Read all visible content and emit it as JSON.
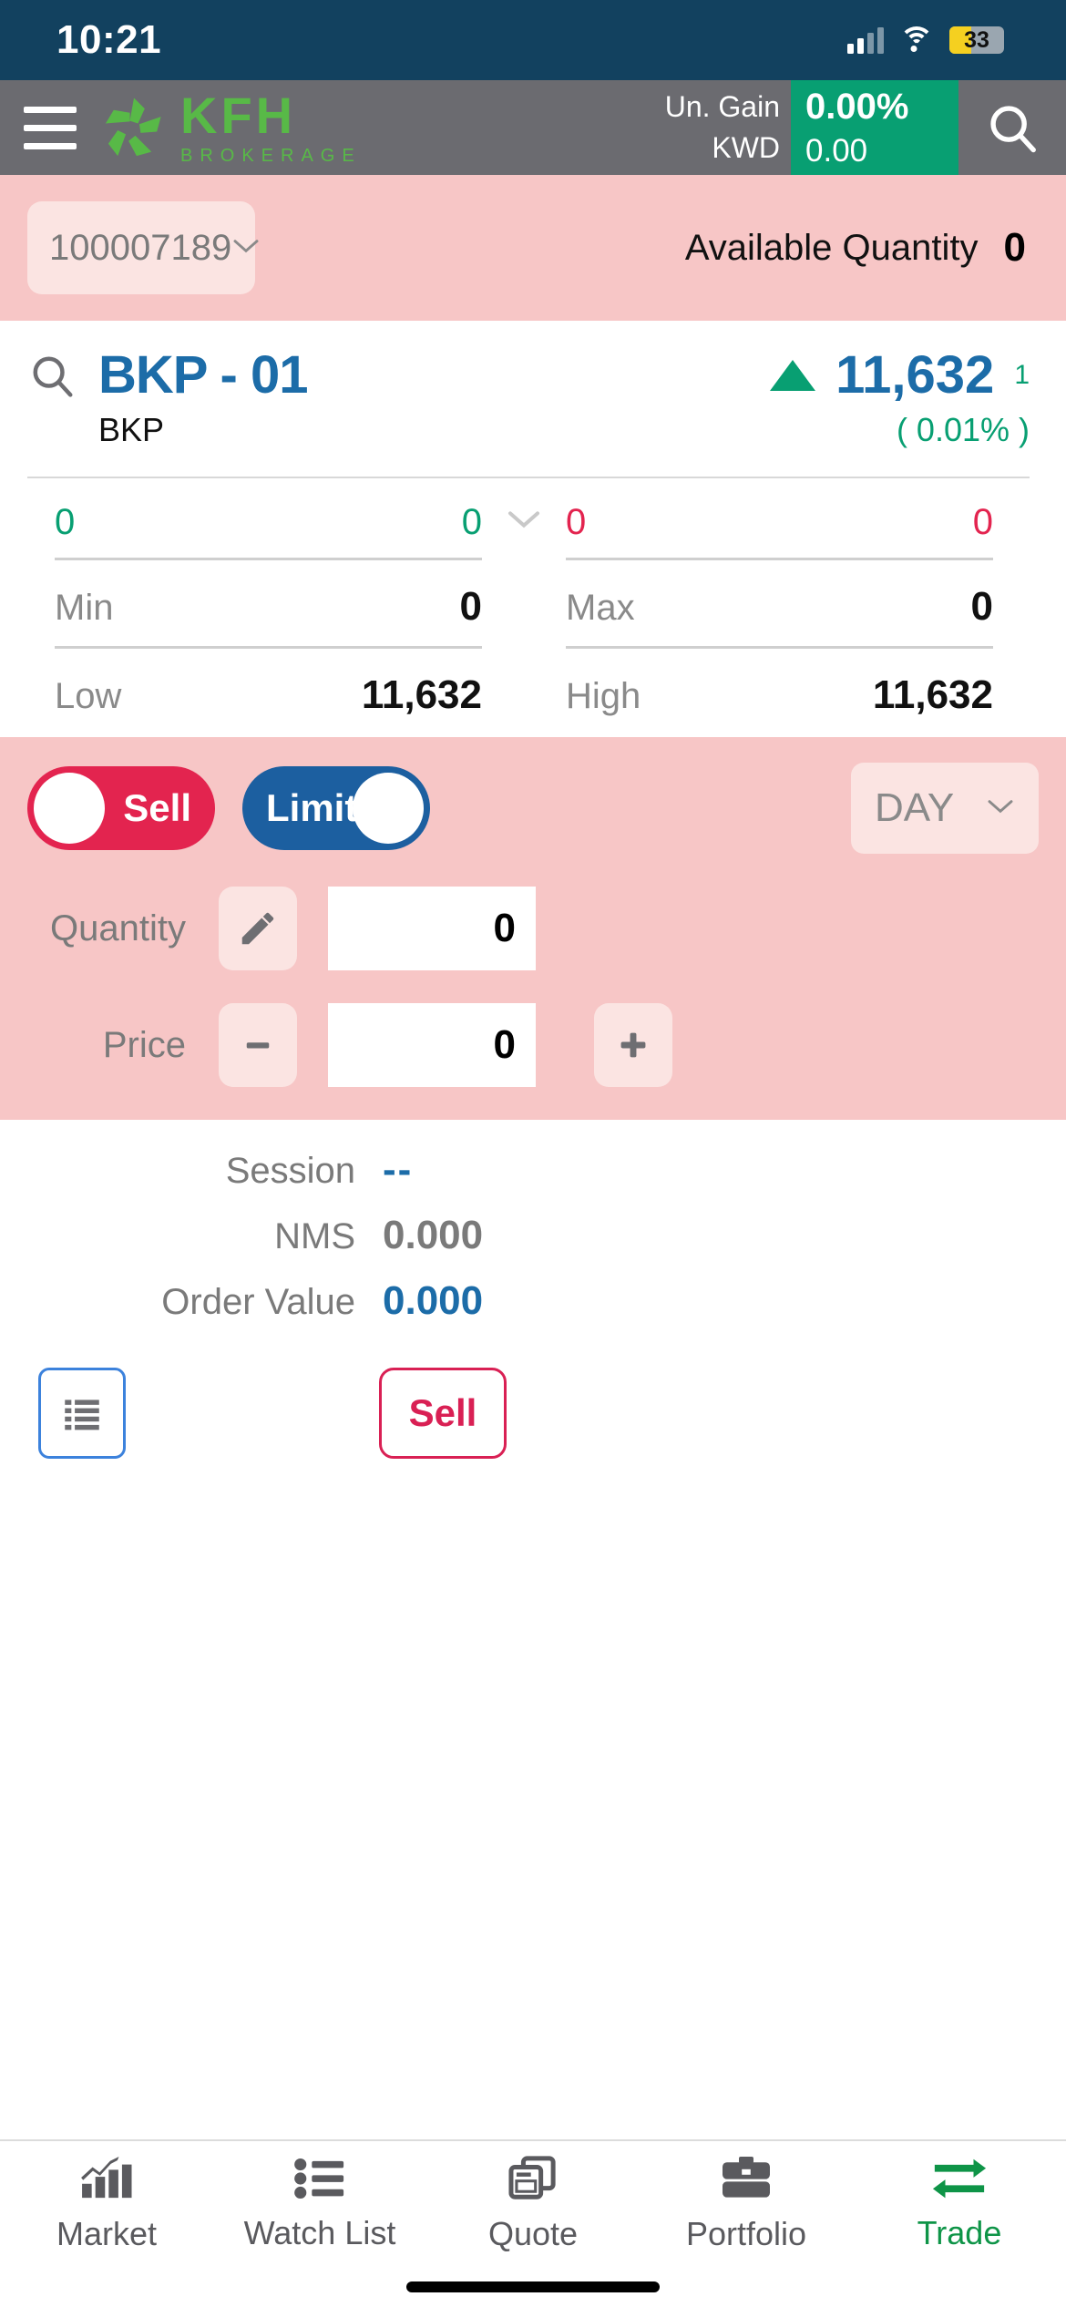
{
  "status_bar": {
    "time": "10:21",
    "battery_level": "33",
    "signal_icon": "cellular-signal-icon",
    "wifi_icon": "wifi-icon",
    "battery_icon": "battery-icon"
  },
  "header": {
    "menu_icon": "hamburger-menu-icon",
    "brand_name": "KFH",
    "brand_sub": "BROKERAGE",
    "logo_icon": "kfh-logo-icon",
    "gain_label": "Un. Gain",
    "gain_percent": "0.00%",
    "currency_label": "KWD",
    "gain_amount": "0.00",
    "search_icon": "search-icon",
    "gain_color": "#089F72"
  },
  "account_bar": {
    "account_number": "100007189",
    "dropdown_icon": "chevron-down-icon",
    "available_quantity_label": "Available Quantity",
    "available_quantity_value": "0"
  },
  "quote": {
    "search_icon": "search-icon",
    "symbol": "BKP - 01",
    "direction_icon": "triangle-up-icon",
    "last_price": "11,632",
    "change": "1",
    "company": "BKP",
    "change_percent": "( 0.01% )",
    "up_color": "#089F72",
    "symbol_color": "#1C6CA8",
    "book": {
      "bid_qty": "0",
      "bid_price": "0",
      "expand_icon": "chevron-down-icon",
      "ask_price": "0",
      "ask_qty": "0"
    },
    "stats": [
      {
        "label": "Min",
        "value": "0",
        "label2": "Max",
        "value2": "0"
      },
      {
        "label": "Low",
        "value": "11,632",
        "label2": "High",
        "value2": "11,632"
      }
    ]
  },
  "order_form": {
    "side_toggle": "Sell",
    "side_color": "#E3244F",
    "order_type_toggle": "Limit",
    "order_type_color": "#1C5FA0",
    "validity": "DAY",
    "validity_dropdown_icon": "chevron-down-icon",
    "quantity_label": "Quantity",
    "quantity_edit_icon": "pencil-icon",
    "quantity_value": "0",
    "price_label": "Price",
    "price_minus_icon": "minus-icon",
    "price_value": "0",
    "price_plus_icon": "plus-icon"
  },
  "summary": {
    "rows": [
      {
        "label": "Session",
        "value": "--",
        "style": "blue"
      },
      {
        "label": "NMS",
        "value": "0.000",
        "style": "grey"
      },
      {
        "label": "Order Value",
        "value": "0.000",
        "style": "blue"
      }
    ],
    "list_button_icon": "list-icon",
    "submit_label": "Sell",
    "submit_color": "#D92054"
  },
  "tabbar": {
    "items": [
      {
        "label": "Market",
        "icon": "bar-chart-icon",
        "active": false
      },
      {
        "label": "Watch List",
        "icon": "list-bullet-icon",
        "active": false
      },
      {
        "label": "Quote",
        "icon": "quote-cards-icon",
        "active": false
      },
      {
        "label": "Portfolio",
        "icon": "briefcase-icon",
        "active": false
      },
      {
        "label": "Trade",
        "icon": "exchange-arrows-icon",
        "active": true
      }
    ],
    "active_color": "#0E9447"
  }
}
